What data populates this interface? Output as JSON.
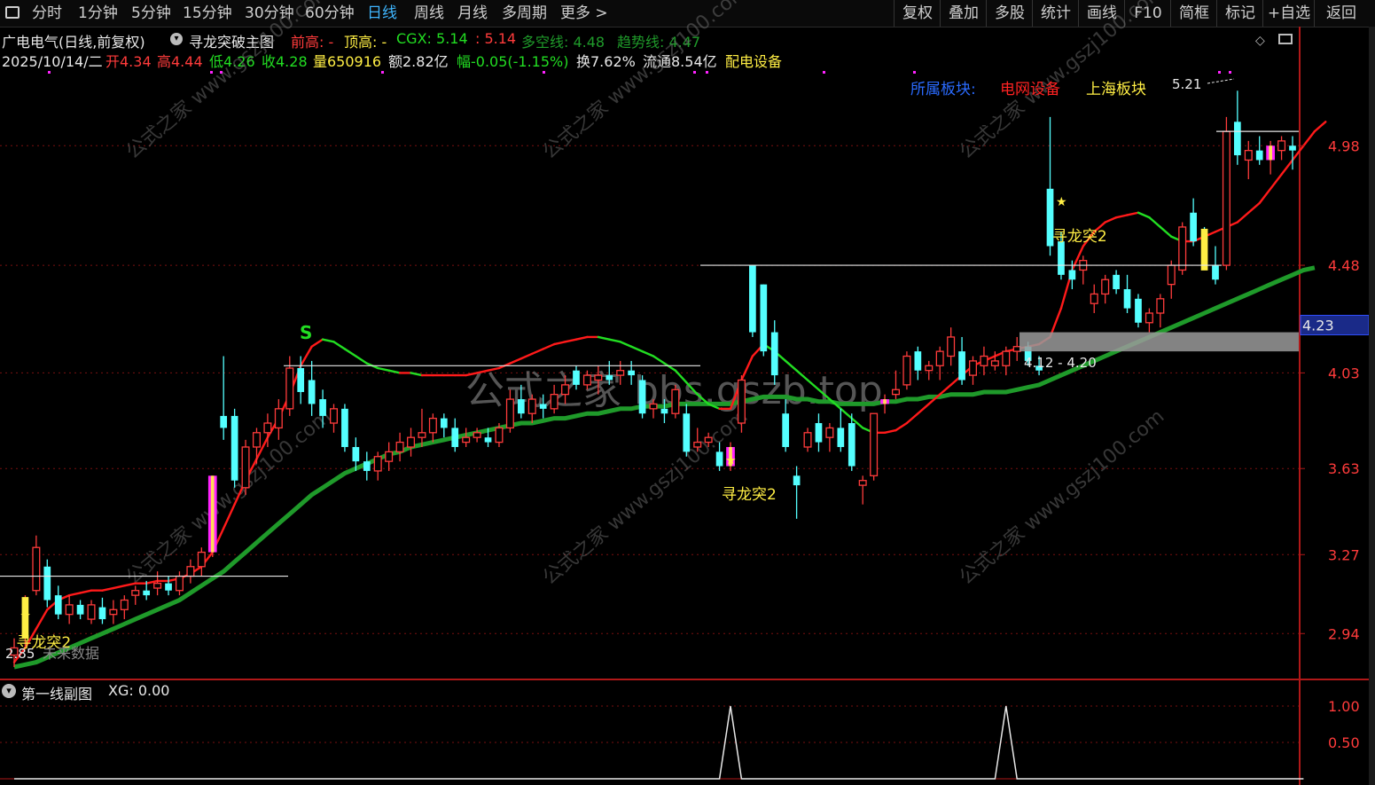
{
  "toolbar": {
    "periods": [
      "分时",
      "1分钟",
      "5分钟",
      "15分钟",
      "30分钟",
      "60分钟",
      "日线",
      "周线",
      "月线",
      "多周期",
      "更多 >"
    ],
    "active_period": "日线",
    "right_buttons": [
      "复权",
      "叠加",
      "多股",
      "统计",
      "画线",
      "F10",
      "简框",
      "标记",
      "+自选",
      "返回"
    ]
  },
  "header": {
    "stock_title": "广电电气(日线,前复权)",
    "indicator_name": "寻龙突破主图",
    "prev_high_label": "前高: -",
    "top_high_label": "顶高: -",
    "cgx_label": "CGX: 5.14",
    "cgx2_label": ": 5.14",
    "duokong_label": "多空线: 4.48",
    "trend_label": "趋势线: 4.47"
  },
  "quote": {
    "date": "2025/10/14/二",
    "open": "开4.34",
    "high": "高4.44",
    "low": "低4.26",
    "close": "收4.28",
    "volume": "量650916",
    "amount": "额2.82亿",
    "change": "幅-0.05(-1.15%)",
    "turnover": "换7.62%",
    "float": "流通8.54亿",
    "sector": "配电设备"
  },
  "sector_tags": {
    "label": "所属板块:",
    "tag1": "电网设备",
    "tag2": "上海板块"
  },
  "annotations": {
    "high_mark": "5.21",
    "zone_label": "4.12 - 4.20",
    "low_mark": "2.85",
    "future_text": "未来数据",
    "signal_label": "寻龙突2",
    "s_mark": "S",
    "watermark_main": "公式之家 bbs.gszb.top",
    "watermark_small": "公式之家 www.gszj100.com"
  },
  "price_axis": {
    "ticks": [
      "4.98",
      "4.48",
      "4.03",
      "3.63",
      "3.27",
      "2.94"
    ],
    "current": "4.23"
  },
  "sub_chart": {
    "title": "第一线副图",
    "xg_label": "XG: 0.00",
    "ticks": [
      "1.00",
      "0.50"
    ]
  },
  "colors": {
    "up": "#ff3b3b",
    "down": "#54ffff",
    "ma_green": "#1f9a2a",
    "curve_red": "#ff1a1a",
    "curve_green": "#22dd22",
    "highlight_magenta": "#ff22ff",
    "highlight_yellow": "#ffee44"
  },
  "chart_data": {
    "type": "candlestick",
    "ylim": [
      2.8,
      5.3
    ],
    "candles": [
      {
        "o": 2.85,
        "h": 2.92,
        "l": 2.8,
        "c": 2.88
      },
      {
        "o": 2.95,
        "h": 3.1,
        "l": 2.88,
        "c": 3.05
      },
      {
        "o": 3.12,
        "h": 3.35,
        "l": 3.1,
        "c": 3.3
      },
      {
        "o": 3.22,
        "h": 3.25,
        "l": 3.05,
        "c": 3.08
      },
      {
        "o": 3.1,
        "h": 3.14,
        "l": 3.0,
        "c": 3.02
      },
      {
        "o": 3.02,
        "h": 3.1,
        "l": 2.98,
        "c": 3.06
      },
      {
        "o": 3.06,
        "h": 3.08,
        "l": 3.0,
        "c": 3.02
      },
      {
        "o": 3.0,
        "h": 3.08,
        "l": 2.98,
        "c": 3.06
      },
      {
        "o": 3.05,
        "h": 3.09,
        "l": 2.98,
        "c": 3.0
      },
      {
        "o": 3.02,
        "h": 3.08,
        "l": 2.98,
        "c": 3.04
      },
      {
        "o": 3.04,
        "h": 3.1,
        "l": 3.0,
        "c": 3.08
      },
      {
        "o": 3.1,
        "h": 3.14,
        "l": 3.06,
        "c": 3.12
      },
      {
        "o": 3.12,
        "h": 3.16,
        "l": 3.08,
        "c": 3.1
      },
      {
        "o": 3.13,
        "h": 3.2,
        "l": 3.1,
        "c": 3.15
      },
      {
        "o": 3.15,
        "h": 3.18,
        "l": 3.1,
        "c": 3.12
      },
      {
        "o": 3.12,
        "h": 3.2,
        "l": 3.1,
        "c": 3.18
      },
      {
        "o": 3.18,
        "h": 3.25,
        "l": 3.15,
        "c": 3.22
      },
      {
        "o": 3.22,
        "h": 3.3,
        "l": 3.18,
        "c": 3.28
      },
      {
        "o": 3.28,
        "h": 3.6,
        "l": 3.26,
        "c": 3.6
      },
      {
        "o": 3.85,
        "h": 4.1,
        "l": 3.75,
        "c": 3.8
      },
      {
        "o": 3.85,
        "h": 3.88,
        "l": 3.55,
        "c": 3.58
      },
      {
        "o": 3.55,
        "h": 3.75,
        "l": 3.52,
        "c": 3.72
      },
      {
        "o": 3.72,
        "h": 3.8,
        "l": 3.65,
        "c": 3.78
      },
      {
        "o": 3.78,
        "h": 3.86,
        "l": 3.72,
        "c": 3.82
      },
      {
        "o": 3.8,
        "h": 3.92,
        "l": 3.75,
        "c": 3.88
      },
      {
        "o": 3.88,
        "h": 4.1,
        "l": 3.85,
        "c": 4.05
      },
      {
        "o": 4.05,
        "h": 4.1,
        "l": 3.9,
        "c": 3.95
      },
      {
        "o": 4.0,
        "h": 4.08,
        "l": 3.85,
        "c": 3.9
      },
      {
        "o": 3.92,
        "h": 3.96,
        "l": 3.8,
        "c": 3.85
      },
      {
        "o": 3.82,
        "h": 3.9,
        "l": 3.78,
        "c": 3.88
      },
      {
        "o": 3.88,
        "h": 3.9,
        "l": 3.7,
        "c": 3.72
      },
      {
        "o": 3.72,
        "h": 3.76,
        "l": 3.62,
        "c": 3.66
      },
      {
        "o": 3.66,
        "h": 3.7,
        "l": 3.58,
        "c": 3.62
      },
      {
        "o": 3.62,
        "h": 3.7,
        "l": 3.58,
        "c": 3.68
      },
      {
        "o": 3.66,
        "h": 3.74,
        "l": 3.62,
        "c": 3.7
      },
      {
        "o": 3.7,
        "h": 3.78,
        "l": 3.66,
        "c": 3.74
      },
      {
        "o": 3.72,
        "h": 3.8,
        "l": 3.68,
        "c": 3.76
      },
      {
        "o": 3.76,
        "h": 3.88,
        "l": 3.72,
        "c": 3.78
      },
      {
        "o": 3.78,
        "h": 3.86,
        "l": 3.74,
        "c": 3.84
      },
      {
        "o": 3.84,
        "h": 3.86,
        "l": 3.76,
        "c": 3.8
      },
      {
        "o": 3.8,
        "h": 3.84,
        "l": 3.7,
        "c": 3.72
      },
      {
        "o": 3.74,
        "h": 3.8,
        "l": 3.72,
        "c": 3.76
      },
      {
        "o": 3.76,
        "h": 3.8,
        "l": 3.74,
        "c": 3.78
      },
      {
        "o": 3.76,
        "h": 3.8,
        "l": 3.72,
        "c": 3.74
      },
      {
        "o": 3.74,
        "h": 3.82,
        "l": 3.72,
        "c": 3.8
      },
      {
        "o": 3.8,
        "h": 3.96,
        "l": 3.78,
        "c": 3.92
      },
      {
        "o": 3.92,
        "h": 3.98,
        "l": 3.84,
        "c": 3.86
      },
      {
        "o": 3.86,
        "h": 3.94,
        "l": 3.82,
        "c": 3.92
      },
      {
        "o": 3.9,
        "h": 3.94,
        "l": 3.84,
        "c": 3.88
      },
      {
        "o": 3.88,
        "h": 3.98,
        "l": 3.86,
        "c": 3.94
      },
      {
        "o": 3.94,
        "h": 4.02,
        "l": 3.9,
        "c": 3.98
      },
      {
        "o": 4.04,
        "h": 4.06,
        "l": 3.96,
        "c": 3.98
      },
      {
        "o": 3.98,
        "h": 4.04,
        "l": 3.96,
        "c": 4.02
      },
      {
        "o": 4.0,
        "h": 4.06,
        "l": 3.94,
        "c": 4.02
      },
      {
        "o": 4.02,
        "h": 4.08,
        "l": 3.98,
        "c": 4.0
      },
      {
        "o": 4.02,
        "h": 4.08,
        "l": 3.98,
        "c": 4.04
      },
      {
        "o": 4.04,
        "h": 4.08,
        "l": 3.98,
        "c": 4.02
      },
      {
        "o": 4.0,
        "h": 4.02,
        "l": 3.84,
        "c": 3.86
      },
      {
        "o": 3.88,
        "h": 3.92,
        "l": 3.84,
        "c": 3.9
      },
      {
        "o": 3.88,
        "h": 3.92,
        "l": 3.82,
        "c": 3.86
      },
      {
        "o": 3.86,
        "h": 3.98,
        "l": 3.84,
        "c": 3.96
      },
      {
        "o": 3.86,
        "h": 3.9,
        "l": 3.68,
        "c": 3.7
      },
      {
        "o": 3.72,
        "h": 3.8,
        "l": 3.7,
        "c": 3.74
      },
      {
        "o": 3.74,
        "h": 3.78,
        "l": 3.72,
        "c": 3.76
      },
      {
        "o": 3.7,
        "h": 3.74,
        "l": 3.62,
        "c": 3.64
      },
      {
        "o": 3.64,
        "h": 3.74,
        "l": 3.62,
        "c": 3.72
      },
      {
        "o": 3.82,
        "h": 4.02,
        "l": 3.78,
        "c": 4.0
      },
      {
        "o": 4.48,
        "h": 4.48,
        "l": 4.18,
        "c": 4.2
      },
      {
        "o": 4.4,
        "h": 4.4,
        "l": 4.1,
        "c": 4.12
      },
      {
        "o": 4.2,
        "h": 4.25,
        "l": 3.98,
        "c": 4.02
      },
      {
        "o": 3.86,
        "h": 3.92,
        "l": 3.7,
        "c": 3.72
      },
      {
        "o": 3.6,
        "h": 3.64,
        "l": 3.42,
        "c": 3.56
      },
      {
        "o": 3.72,
        "h": 3.8,
        "l": 3.7,
        "c": 3.78
      },
      {
        "o": 3.82,
        "h": 3.86,
        "l": 3.7,
        "c": 3.74
      },
      {
        "o": 3.76,
        "h": 3.82,
        "l": 3.7,
        "c": 3.8
      },
      {
        "o": 3.8,
        "h": 3.88,
        "l": 3.7,
        "c": 3.72
      },
      {
        "o": 3.82,
        "h": 3.86,
        "l": 3.62,
        "c": 3.64
      },
      {
        "o": 3.56,
        "h": 3.6,
        "l": 3.48,
        "c": 3.58
      },
      {
        "o": 3.6,
        "h": 3.86,
        "l": 3.58,
        "c": 3.86
      },
      {
        "o": 3.9,
        "h": 3.94,
        "l": 3.86,
        "c": 3.92
      },
      {
        "o": 3.94,
        "h": 4.04,
        "l": 3.92,
        "c": 3.96
      },
      {
        "o": 3.98,
        "h": 4.12,
        "l": 3.96,
        "c": 4.1
      },
      {
        "o": 4.12,
        "h": 4.14,
        "l": 4.0,
        "c": 4.04
      },
      {
        "o": 4.04,
        "h": 4.08,
        "l": 4.0,
        "c": 4.06
      },
      {
        "o": 4.06,
        "h": 4.14,
        "l": 4.0,
        "c": 4.12
      },
      {
        "o": 4.1,
        "h": 4.22,
        "l": 4.06,
        "c": 4.18
      },
      {
        "o": 4.12,
        "h": 4.18,
        "l": 3.98,
        "c": 4.0
      },
      {
        "o": 4.02,
        "h": 4.1,
        "l": 3.98,
        "c": 4.08
      },
      {
        "o": 4.06,
        "h": 4.14,
        "l": 4.02,
        "c": 4.1
      },
      {
        "o": 4.06,
        "h": 4.12,
        "l": 4.04,
        "c": 4.08
      },
      {
        "o": 4.06,
        "h": 4.14,
        "l": 4.02,
        "c": 4.12
      },
      {
        "o": 4.12,
        "h": 4.18,
        "l": 4.08,
        "c": 4.14
      },
      {
        "o": 4.14,
        "h": 4.16,
        "l": 4.06,
        "c": 4.08
      },
      {
        "o": 4.06,
        "h": 4.1,
        "l": 4.02,
        "c": 4.04
      },
      {
        "o": 4.8,
        "h": 5.1,
        "l": 4.52,
        "c": 4.56
      },
      {
        "o": 4.58,
        "h": 4.62,
        "l": 4.42,
        "c": 4.44
      },
      {
        "o": 4.46,
        "h": 4.5,
        "l": 4.38,
        "c": 4.42
      },
      {
        "o": 4.46,
        "h": 4.52,
        "l": 4.4,
        "c": 4.5
      },
      {
        "o": 4.32,
        "h": 4.4,
        "l": 4.28,
        "c": 4.36
      },
      {
        "o": 4.36,
        "h": 4.44,
        "l": 4.32,
        "c": 4.42
      },
      {
        "o": 4.44,
        "h": 4.46,
        "l": 4.36,
        "c": 4.38
      },
      {
        "o": 4.38,
        "h": 4.44,
        "l": 4.28,
        "c": 4.3
      },
      {
        "o": 4.34,
        "h": 4.36,
        "l": 4.22,
        "c": 4.24
      },
      {
        "o": 4.24,
        "h": 4.3,
        "l": 4.2,
        "c": 4.28
      },
      {
        "o": 4.28,
        "h": 4.36,
        "l": 4.22,
        "c": 4.34
      },
      {
        "o": 4.4,
        "h": 4.5,
        "l": 4.34,
        "c": 4.48
      },
      {
        "o": 4.46,
        "h": 4.66,
        "l": 4.44,
        "c": 4.64
      },
      {
        "o": 4.7,
        "h": 4.76,
        "l": 4.56,
        "c": 4.58
      },
      {
        "o": 4.6,
        "h": 4.64,
        "l": 4.48,
        "c": 4.5
      },
      {
        "o": 4.48,
        "h": 4.56,
        "l": 4.4,
        "c": 4.42
      },
      {
        "o": 4.48,
        "h": 5.1,
        "l": 4.46,
        "c": 5.04
      },
      {
        "o": 5.08,
        "h": 5.21,
        "l": 4.9,
        "c": 4.94
      },
      {
        "o": 4.92,
        "h": 5.0,
        "l": 4.84,
        "c": 4.96
      },
      {
        "o": 4.96,
        "h": 5.02,
        "l": 4.9,
        "c": 4.92
      },
      {
        "o": 4.92,
        "h": 5.0,
        "l": 4.86,
        "c": 4.98
      },
      {
        "o": 4.96,
        "h": 5.02,
        "l": 4.92,
        "c": 5.0
      },
      {
        "o": 4.98,
        "h": 5.02,
        "l": 4.88,
        "c": 4.96
      }
    ],
    "ma_line": [
      2.8,
      2.81,
      2.82,
      2.84,
      2.86,
      2.88,
      2.9,
      2.92,
      2.94,
      2.96,
      2.98,
      3.0,
      3.02,
      3.04,
      3.06,
      3.08,
      3.11,
      3.14,
      3.17,
      3.2,
      3.24,
      3.28,
      3.32,
      3.36,
      3.4,
      3.44,
      3.48,
      3.52,
      3.55,
      3.58,
      3.61,
      3.63,
      3.65,
      3.67,
      3.69,
      3.7,
      3.72,
      3.73,
      3.74,
      3.75,
      3.76,
      3.77,
      3.78,
      3.79,
      3.8,
      3.81,
      3.82,
      3.82,
      3.83,
      3.84,
      3.84,
      3.85,
      3.86,
      3.86,
      3.87,
      3.88,
      3.88,
      3.89,
      3.89,
      3.89,
      3.9,
      3.9,
      3.9,
      3.9,
      3.9,
      3.9,
      3.91,
      3.92,
      3.93,
      3.93,
      3.93,
      3.92,
      3.92,
      3.91,
      3.91,
      3.9,
      3.9,
      3.9,
      3.9,
      3.91,
      3.91,
      3.92,
      3.92,
      3.93,
      3.93,
      3.94,
      3.94,
      3.94,
      3.95,
      3.95,
      3.95,
      3.96,
      3.97,
      3.98,
      4.0,
      4.02,
      4.04,
      4.06,
      4.08,
      4.1,
      4.12,
      4.14,
      4.16,
      4.18,
      4.2,
      4.22,
      4.24,
      4.26,
      4.28,
      4.3,
      4.32,
      4.34,
      4.36,
      4.38,
      4.4,
      4.42,
      4.44,
      4.46,
      4.47
    ],
    "curve_line": [
      2.82,
      2.88,
      2.96,
      3.04,
      3.08,
      3.1,
      3.11,
      3.12,
      3.12,
      3.13,
      3.14,
      3.15,
      3.15,
      3.16,
      3.16,
      3.17,
      3.19,
      3.22,
      3.28,
      3.38,
      3.48,
      3.58,
      3.67,
      3.76,
      3.84,
      3.94,
      4.06,
      4.14,
      4.17,
      4.16,
      4.13,
      4.1,
      4.07,
      4.05,
      4.04,
      4.03,
      4.03,
      4.02,
      4.02,
      4.02,
      4.02,
      4.02,
      4.03,
      4.04,
      4.05,
      4.07,
      4.09,
      4.11,
      4.13,
      4.15,
      4.16,
      4.17,
      4.18,
      4.18,
      4.17,
      4.16,
      4.14,
      4.12,
      4.1,
      4.07,
      4.04,
      3.99,
      3.94,
      3.9,
      3.88,
      3.88,
      4.0,
      4.1,
      4.15,
      4.12,
      4.08,
      4.04,
      4.0,
      3.96,
      3.92,
      3.88,
      3.84,
      3.8,
      3.78,
      3.78,
      3.79,
      3.82,
      3.86,
      3.9,
      3.94,
      3.98,
      4.02,
      4.06,
      4.08,
      4.1,
      4.12,
      4.13,
      4.14,
      4.15,
      4.18,
      4.3,
      4.46,
      4.56,
      4.62,
      4.66,
      4.68,
      4.69,
      4.7,
      4.68,
      4.64,
      4.6,
      4.58,
      4.58,
      4.6,
      4.62,
      4.64,
      4.66,
      4.7,
      4.74,
      4.8,
      4.86,
      4.92,
      4.98,
      5.04,
      5.08
    ],
    "sub_values": [
      0,
      0,
      0,
      0,
      0,
      0,
      0,
      0,
      0,
      0,
      0,
      0,
      0,
      0,
      0,
      0,
      0,
      0,
      0,
      0,
      0,
      0,
      0,
      0,
      0,
      0,
      0,
      0,
      0,
      0,
      0,
      0,
      0,
      0,
      0,
      0,
      0,
      0,
      0,
      0,
      0,
      0,
      0,
      0,
      0,
      0,
      0,
      0,
      0,
      0,
      0,
      0,
      0,
      0,
      0,
      0,
      0,
      0,
      0,
      0,
      0,
      0,
      0,
      0,
      0,
      1,
      0,
      0,
      0,
      0,
      0,
      0,
      0,
      0,
      0,
      0,
      0,
      0,
      0,
      0,
      0,
      0,
      0,
      0,
      0,
      0,
      0,
      0,
      0,
      0,
      1,
      0,
      0,
      0,
      0,
      0,
      0,
      0,
      0,
      0,
      0,
      0,
      0,
      0,
      0,
      0,
      0,
      0,
      0,
      0,
      0,
      0,
      0,
      0,
      0,
      0,
      0,
      0
    ]
  }
}
